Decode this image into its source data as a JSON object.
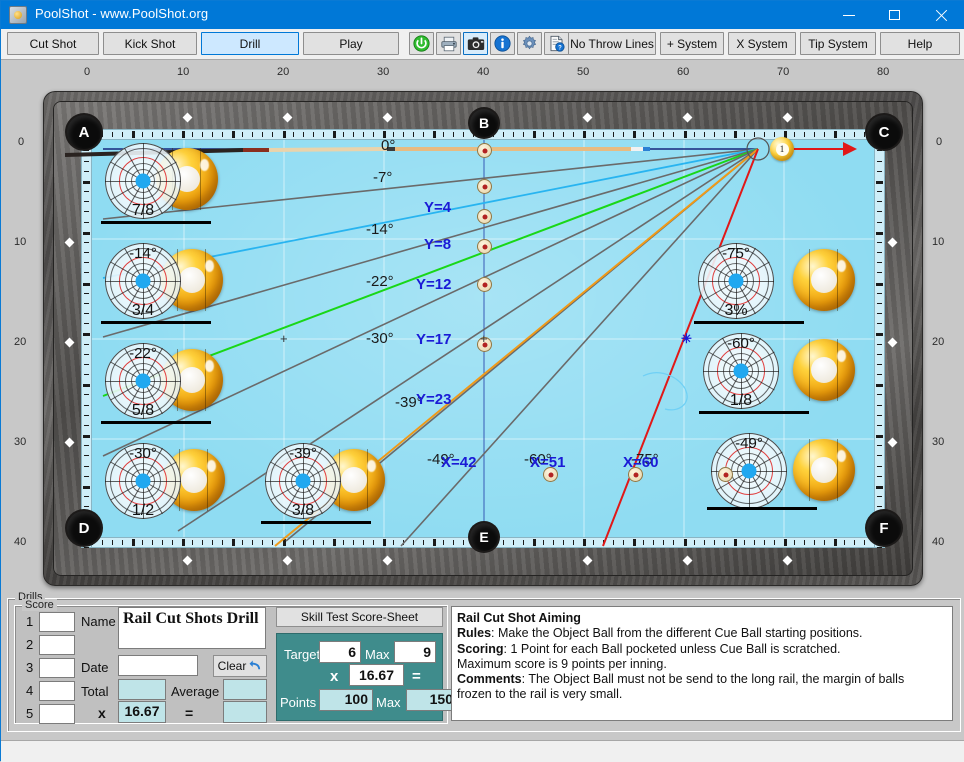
{
  "window": {
    "title": "PoolShot - www.PoolShot.org",
    "icon": "app-icon",
    "minimize": "—",
    "maximize": "□",
    "close": "✕"
  },
  "toolbar": {
    "tabs": [
      {
        "label": "Cut Shot",
        "selected": false
      },
      {
        "label": "Kick Shot",
        "selected": false
      },
      {
        "label": "Drill",
        "selected": true
      },
      {
        "label": "Play",
        "selected": false
      }
    ],
    "icons": [
      {
        "name": "power-icon",
        "glyph": "⏻",
        "color": "#1fa81f",
        "focused": false
      },
      {
        "name": "printer-icon",
        "glyph": "🖨",
        "color": "#4a5a6a",
        "focused": false
      },
      {
        "name": "camera-icon",
        "glyph": "📷",
        "color": "#222222",
        "focused": true
      },
      {
        "name": "info-icon",
        "glyph": "i",
        "color": "#1673d2",
        "focused": false
      },
      {
        "name": "gear-icon",
        "glyph": "⚙",
        "color": "#5a7fa8",
        "focused": false
      },
      {
        "name": "help-document-icon",
        "glyph": "?",
        "color": "#2a4a7a",
        "focused": false
      }
    ],
    "options": [
      {
        "label": "No Throw Lines"
      },
      {
        "label": "+ System"
      },
      {
        "label": "X System"
      },
      {
        "label": "Tip System"
      },
      {
        "label": "Help"
      }
    ]
  },
  "table": {
    "axis_top": [
      "0",
      "10",
      "20",
      "30",
      "40",
      "50",
      "60",
      "70",
      "80"
    ],
    "axis_left": [
      "0",
      "10",
      "20",
      "30",
      "40"
    ],
    "axis_right": [
      "0",
      "10",
      "20",
      "30",
      "40"
    ],
    "pockets": [
      "A",
      "B",
      "C",
      "D",
      "E",
      "F"
    ],
    "cue_ball_number": "1",
    "ghost_balls": [
      {
        "angle": "0°",
        "fraction": "7/8"
      },
      {
        "angle": "-14°",
        "fraction": "3/4"
      },
      {
        "angle": "-22°",
        "fraction": "5/8"
      },
      {
        "angle": "-30°",
        "fraction": "1/2"
      },
      {
        "angle": "-39°",
        "fraction": "3/8"
      },
      {
        "angle": "-49°",
        "fraction": ""
      },
      {
        "angle": "-60°",
        "fraction": "1/8"
      },
      {
        "angle": "-75°",
        "fraction": "3%"
      }
    ],
    "angle_labels": [
      "0°",
      "-7°",
      "-14°",
      "-22°",
      "-30°",
      "-39°",
      "-49°",
      "-60°",
      "-75°"
    ],
    "axis_markers": [
      "Y=4",
      "Y=8",
      "Y=12",
      "Y=17",
      "Y=23",
      "X=42",
      "X=51",
      "X=60"
    ]
  },
  "drills": {
    "group_label": "Drills",
    "score": {
      "group_label": "Score",
      "rows": [
        "1",
        "2",
        "3",
        "4",
        "5"
      ],
      "row_values": [
        "",
        "",
        "",
        "",
        ""
      ],
      "name_label": "Name",
      "name_value": "Rail Cut Shots Drill",
      "date_label": "Date",
      "date_value": "",
      "clear_label": "Clear",
      "total_label": "Total",
      "total_value": "",
      "average_label": "Average",
      "average_value": "",
      "multiply_label": "x",
      "multiplier_value": "16.67",
      "equals_label": "=",
      "result_value": ""
    },
    "skilltest": {
      "title": "Skill Test Score-Sheet",
      "target_label": "Target",
      "target_value": "6",
      "target_max_label": "Max",
      "target_max_value": "9",
      "multiply_label": "x",
      "multiplier_value": "16.67",
      "equals_label": "=",
      "points_label": "Points",
      "points_value": "100",
      "points_max_label": "Max",
      "points_max_value": "150"
    },
    "description": {
      "title": "Rail Cut Shot Aiming",
      "rules_label": "Rules",
      "rules_text": ": Make the Object Ball from the different Cue Ball starting positions.",
      "scoring_label": "Scoring",
      "scoring_text": ": 1 Point for each Ball pocketed unless Cue Ball is scratched.",
      "scoring_line2": "Maximum score is 9 points per inning.",
      "comments_label": "Comments",
      "comments_text": ": The Object Ball must not be send to the long rail, the margin of balls",
      "comments_line2": "frozen to the rail is very small."
    }
  },
  "colors": {
    "accent": "#0078d7",
    "cloth": "#8fdcf2",
    "teal": "#3f8c8c",
    "marker_blue": "#1a1ad6"
  }
}
